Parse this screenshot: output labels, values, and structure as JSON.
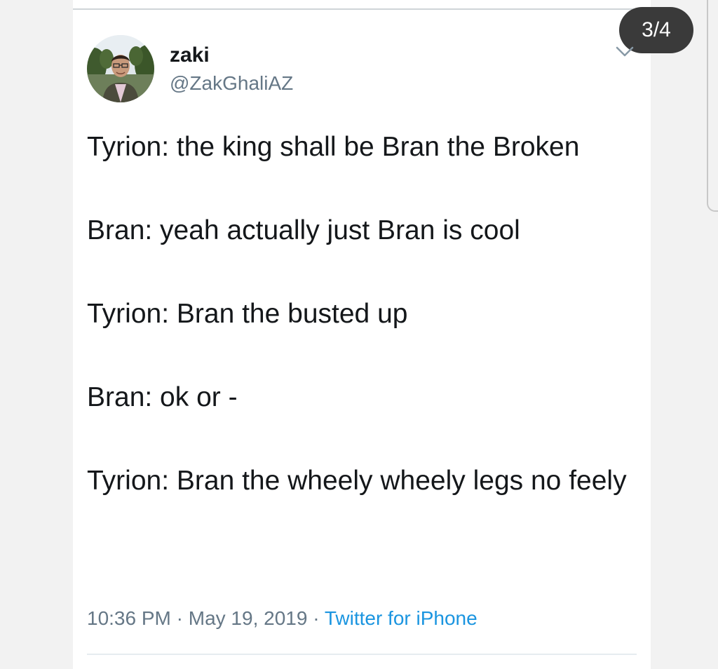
{
  "pager": {
    "label": "3/4"
  },
  "user": {
    "name": "zaki",
    "handle": "@ZakGhaliAZ"
  },
  "tweet": {
    "lines": [
      "Tyrion: the king shall be Bran the Broken",
      "Bran: yeah actually just Bran is cool",
      "Tyrion: Bran the busted up",
      "Bran: ok or -",
      "Tyrion: Bran the wheely wheely legs no feely"
    ],
    "time": "10:36 PM",
    "separator": "·",
    "date": "May 19, 2019",
    "source": "Twitter for iPhone"
  },
  "colors": {
    "link": "#1b95e0",
    "secondary_text": "#657786",
    "primary_text": "#14171a",
    "pager_bg": "#3a3a3a"
  },
  "icons": {
    "menu": "chevron-down-icon",
    "avatar": "profile-photo"
  }
}
